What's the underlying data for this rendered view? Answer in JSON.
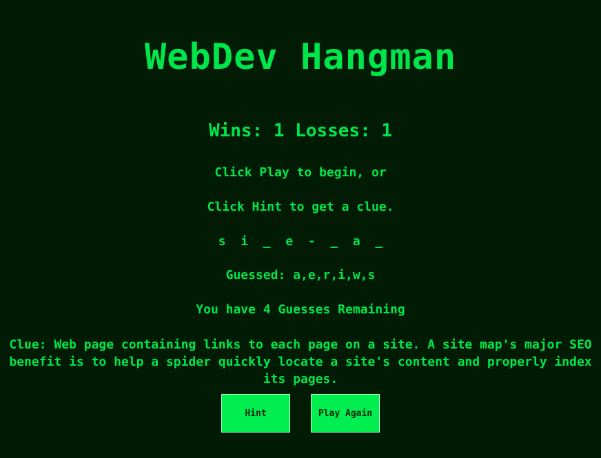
{
  "header": {
    "title": "WebDev Hangman"
  },
  "score": {
    "text": "Wins: 1 Losses: 1"
  },
  "instructions": {
    "line1": "Click Play to begin, or",
    "line2": "Click Hint to get a clue."
  },
  "puzzle": {
    "display": "s  i  _  e  -  _  a  _"
  },
  "guessed": {
    "text": "Guessed: a,e,r,i,w,s"
  },
  "remaining": {
    "text": "You have 4 Guesses Remaining"
  },
  "clue": {
    "text": "Clue: Web page containing links to each page on a site. A site map's major SEO benefit is to help a spider quickly locate a site's content and properly index its pages."
  },
  "buttons": {
    "hint_label": "Hint",
    "play_again_label": "Play Again"
  },
  "colors": {
    "background": "#021b05",
    "text": "#00e64a",
    "button_bg": "#00ee50"
  }
}
